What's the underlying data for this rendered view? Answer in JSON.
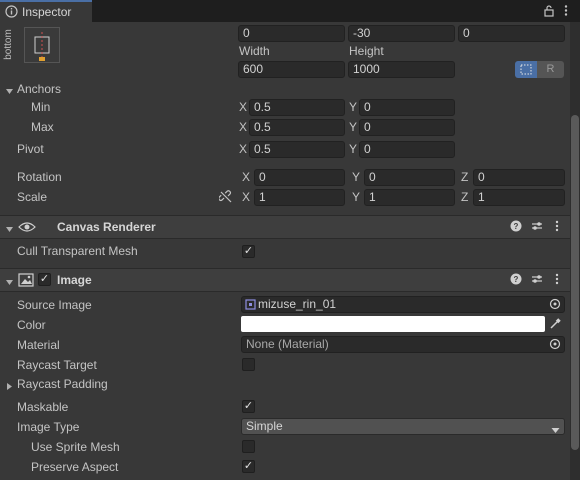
{
  "tab": {
    "title": "Inspector",
    "icon": "info-icon"
  },
  "rect": {
    "preset_vertical_label": "bottom",
    "pos": [
      "0",
      "-30",
      "0"
    ],
    "size_labels": [
      "Width",
      "Height"
    ],
    "size": [
      "600",
      "1000"
    ],
    "blueprint_icon": "dotted-rect-icon",
    "raw_button": "R"
  },
  "anchors": {
    "label": "Anchors",
    "min_label": "Min",
    "min": {
      "x": "0.5",
      "y": "0"
    },
    "max_label": "Max",
    "max": {
      "x": "0.5",
      "y": "0"
    }
  },
  "pivot": {
    "label": "Pivot",
    "x": "0.5",
    "y": "0"
  },
  "rotation": {
    "label": "Rotation",
    "x": "0",
    "y": "0",
    "z": "0"
  },
  "scale": {
    "label": "Scale",
    "x": "1",
    "y": "1",
    "z": "1"
  },
  "axis_labels": {
    "x": "X",
    "y": "Y",
    "z": "Z"
  },
  "canvas_renderer": {
    "title": "Canvas Renderer",
    "cull_label": "Cull Transparent Mesh",
    "cull_checked": "✓"
  },
  "image": {
    "title": "Image",
    "enabled_check": "✓",
    "source_image_label": "Source Image",
    "source_image": "mizuse_rin_01",
    "color_label": "Color",
    "color_value": "#ffffff",
    "material_label": "Material",
    "material": "None (Material)",
    "raycast_target_label": "Raycast Target",
    "raycast_padding_label": "Raycast Padding",
    "maskable_label": "Maskable",
    "maskable_check": "✓",
    "image_type_label": "Image Type",
    "image_type": "Simple",
    "use_sprite_mesh_label": "Use Sprite Mesh",
    "preserve_aspect_label": "Preserve Aspect",
    "preserve_aspect_check": "✓"
  },
  "colors": {
    "accent": "#4a6fa5",
    "background": "#383838",
    "field": "#2a2a2a"
  }
}
